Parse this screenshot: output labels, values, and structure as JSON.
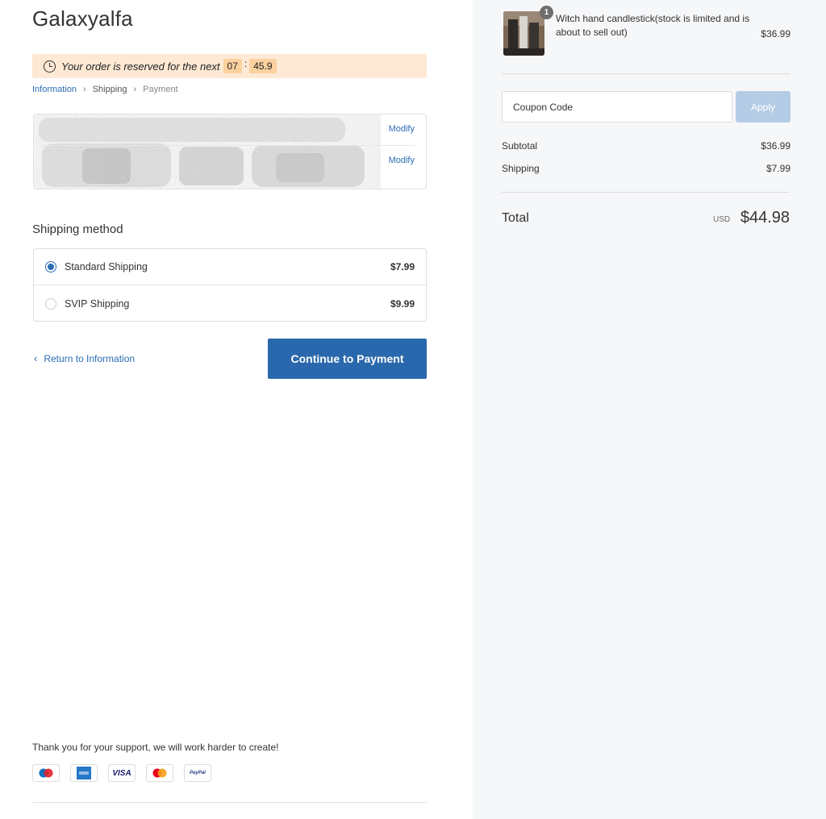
{
  "store": {
    "name": "Galaxyalfa"
  },
  "reservation": {
    "message": "Your order is reserved for the next",
    "minutes": "07",
    "separator": ":",
    "seconds": "45.9"
  },
  "breadcrumb": [
    "Information",
    "Shipping",
    "Payment"
  ],
  "contact_box": {
    "modify_label_1": "Modify",
    "modify_label_2": "Modify"
  },
  "shipping": {
    "title": "Shipping method",
    "options": [
      {
        "label": "Standard Shipping",
        "price": "$7.99",
        "selected": true
      },
      {
        "label": "SVIP Shipping",
        "price": "$9.99",
        "selected": false
      }
    ]
  },
  "actions": {
    "return_label": "Return to Information",
    "continue_label": "Continue to Payment"
  },
  "footer": {
    "thanks": "Thank you for your support, we will work harder to create!",
    "payment_icons": [
      "maestro-icon",
      "amex-icon",
      "visa-icon",
      "mastercard-icon",
      "paypal-icon"
    ],
    "visa_text": "VISA",
    "paypal_text": "PayPal"
  },
  "summary": {
    "product": {
      "name": "Witch hand candlestick(stock is limited and is about to sell out)",
      "price": "$36.99",
      "quantity": "1"
    },
    "coupon_placeholder": "Coupon Code",
    "apply_label": "Apply",
    "subtotal_label": "Subtotal",
    "subtotal_value": "$36.99",
    "shipping_label": "Shipping",
    "shipping_value": "$7.99",
    "total_label": "Total",
    "currency": "USD",
    "total_value": "$44.98"
  },
  "colors": {
    "accent": "#2a68ad",
    "reserve_bg": "#fde9d4",
    "timer_bg": "#fbd19f",
    "apply_disabled": "#b5cce6"
  }
}
